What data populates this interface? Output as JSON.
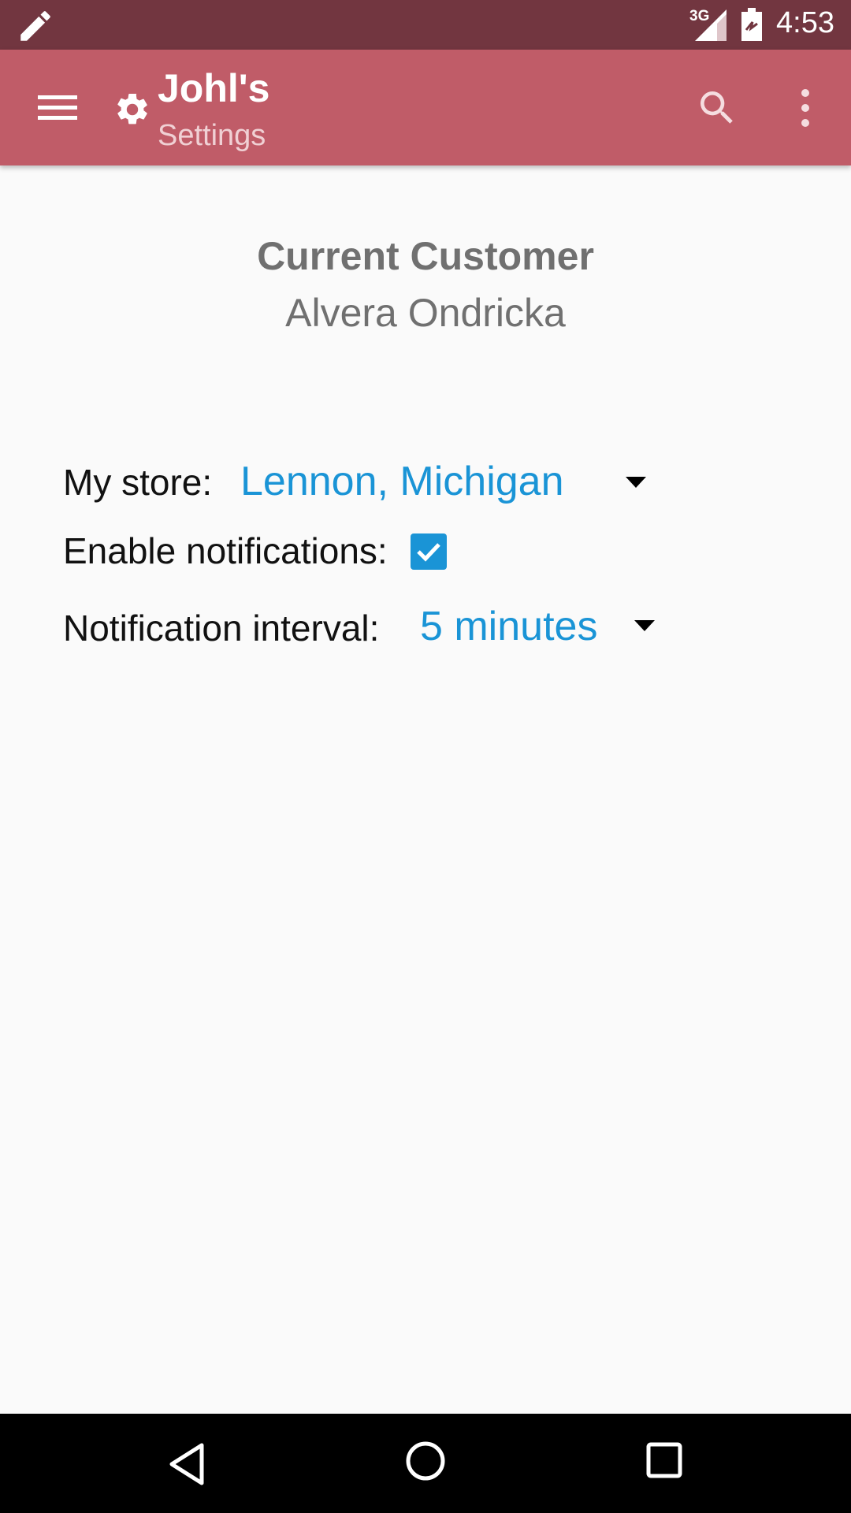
{
  "status_bar": {
    "network_label": "3G",
    "time": "4:53",
    "icons": [
      "pencil-icon",
      "signal-icon",
      "battery-icon"
    ]
  },
  "app_bar": {
    "title": "Johl's",
    "subtitle": "Settings",
    "icons": [
      "menu-icon",
      "gear-icon",
      "search-icon",
      "overflow-menu-icon"
    ],
    "color": "#c05c68"
  },
  "customer": {
    "heading": "Current Customer",
    "name": "Alvera Ondricka"
  },
  "settings": {
    "store": {
      "label": "My store:",
      "value": "Lennon, Michigan"
    },
    "notifications": {
      "label": "Enable notifications:",
      "checked": true
    },
    "interval": {
      "label": "Notification interval:",
      "value": "5 minutes"
    }
  },
  "accent_color": "#1a94d6",
  "nav_bar": {
    "icons": [
      "back-icon",
      "home-icon",
      "recents-icon"
    ]
  }
}
